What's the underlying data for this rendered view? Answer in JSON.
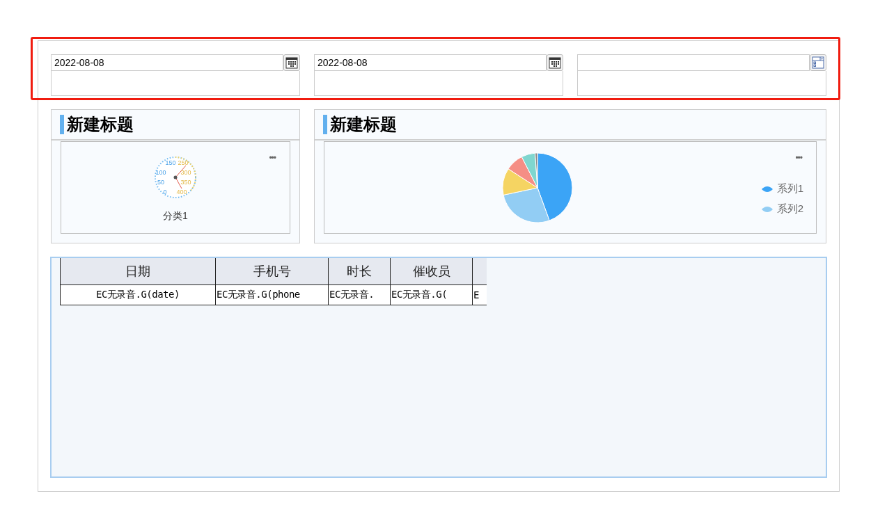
{
  "filters": [
    {
      "value": "2022-08-08",
      "kind": "date"
    },
    {
      "value": "2022-08-08",
      "kind": "date"
    },
    {
      "kind": "select"
    }
  ],
  "panels": [
    {
      "title": "新建标题",
      "kind": "gauge",
      "gauge_ticks": [
        "150",
        "250",
        "100",
        "300",
        "50",
        "350",
        "0",
        "400"
      ],
      "category": "分类1",
      "more": "•••"
    },
    {
      "title": "新建标题",
      "kind": "pie",
      "legend": [
        {
          "label": "系列1",
          "color": "#3ba4f6"
        },
        {
          "label": "系列2",
          "color": "#92cdf4"
        }
      ],
      "more": "•••"
    }
  ],
  "table": {
    "columns": [
      "日期",
      "手机号",
      "时长",
      "催收员",
      ""
    ],
    "rows": [
      [
        "EC无录音.G(date)",
        "EC无录音.G(phone",
        "EC无录音.",
        "EC无录音.G(",
        "E"
      ]
    ]
  }
}
